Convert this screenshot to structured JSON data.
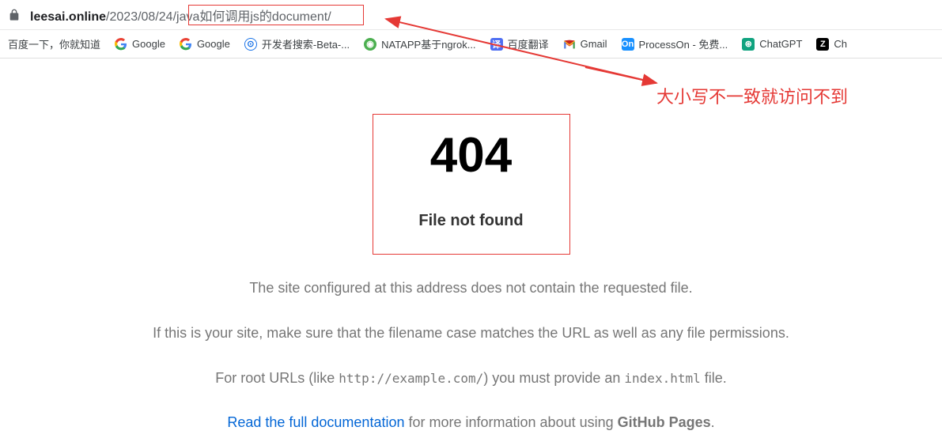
{
  "url": {
    "domain": "leesai.online",
    "path": "/2023/08/24/java如何调用js的document/"
  },
  "bookmarks": [
    {
      "label": "百度一下，你就知道",
      "icon": ""
    },
    {
      "label": "Google",
      "icon": "G"
    },
    {
      "label": "Google",
      "icon": "G"
    },
    {
      "label": "开发者搜索-Beta-...",
      "icon": "⊙"
    },
    {
      "label": "NATAPP基于ngrok...",
      "icon": "◉"
    },
    {
      "label": "百度翻译",
      "icon": "译"
    },
    {
      "label": "Gmail",
      "icon": "M"
    },
    {
      "label": "ProcessOn - 免费...",
      "icon": "On"
    },
    {
      "label": "ChatGPT",
      "icon": "⊛"
    },
    {
      "label": "Ch",
      "icon": "Z"
    }
  ],
  "error": {
    "code": "404",
    "text": "File not found"
  },
  "messages": {
    "line1": "The site configured at this address does not contain the requested file.",
    "line2a": "If this is your site, make sure that the filename case matches the URL as well as any file permissions.",
    "line3_prefix": "For root URLs (like ",
    "line3_code1": "http://example.com/",
    "line3_mid": ") you must provide an ",
    "line3_code2": "index.html",
    "line3_suffix": " file.",
    "line4_link": "Read the full documentation",
    "line4_mid": " for more information about using ",
    "line4_bold": "GitHub Pages",
    "line4_suffix": "."
  },
  "annotation": "大小写不一致就访问不到"
}
